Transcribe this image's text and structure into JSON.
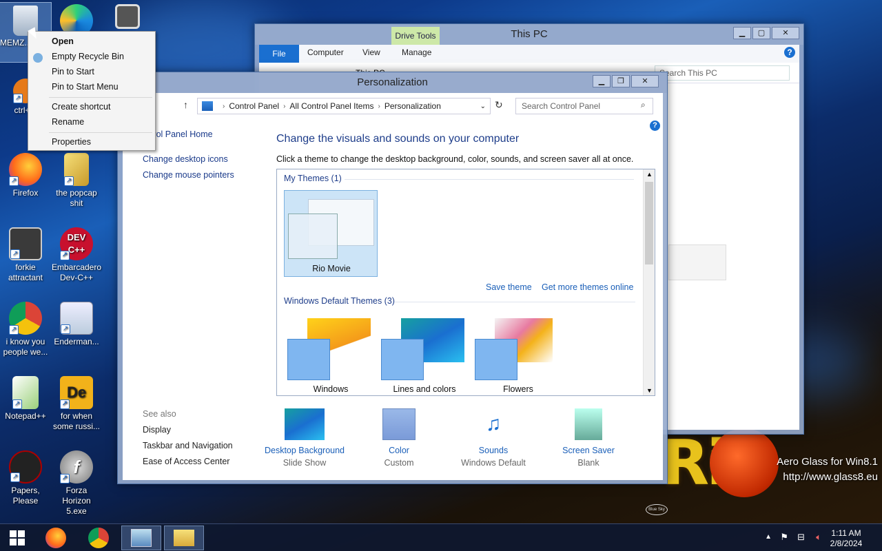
{
  "desktop": {
    "icons": [
      {
        "id": "recycle",
        "label": "MEMZ...uctive"
      },
      {
        "id": "edge",
        "label": ""
      },
      {
        "id": "stack",
        "label": ""
      },
      {
        "id": "ctrl",
        "label": "ctrl+a,"
      },
      {
        "id": "firefox",
        "label": "Firefox"
      },
      {
        "id": "popcap",
        "label": "the popcap shit"
      },
      {
        "id": "forkie",
        "label": "forkie attractant"
      },
      {
        "id": "devcpp",
        "label": "Embarcadero Dev-C++"
      },
      {
        "id": "chrome",
        "label": "i know you people we..."
      },
      {
        "id": "enderman",
        "label": "Enderman..."
      },
      {
        "id": "notepad",
        "label": "Notepad++"
      },
      {
        "id": "russian",
        "label": "for when some russi..."
      },
      {
        "id": "papers",
        "label": "Papers, Please"
      },
      {
        "id": "forza",
        "label": "Forza Horizon 5.exe"
      }
    ],
    "watermark_line1": "Aero Glass for Win8.1",
    "watermark_line2": "http://www.glass8.eu",
    "devcpp_badge": "DEV C++",
    "rio_text": "RiO",
    "bluesky": "Blue Sky"
  },
  "context_menu": {
    "items": [
      "Open",
      "Empty Recycle Bin",
      "Pin to Start",
      "Pin to Start Menu",
      "Create shortcut",
      "Rename",
      "Properties"
    ]
  },
  "explorer": {
    "title": "This PC",
    "drive_tools": "Drive Tools",
    "tabs": [
      "File",
      "Computer",
      "View",
      "Manage"
    ],
    "address": "This PC",
    "search_placeholder": "Search This PC"
  },
  "personalization": {
    "title": "Personalization",
    "breadcrumb": [
      "Control Panel",
      "All Control Panel Items",
      "Personalization"
    ],
    "search_placeholder": "Search Control Panel",
    "left_links": [
      "Control Panel Home",
      "Change desktop icons",
      "Change mouse pointers"
    ],
    "heading": "Change the visuals and sounds on your computer",
    "description": "Click a theme to change the desktop background, color, sounds, and screen saver all at once.",
    "my_themes_label": "My Themes (1)",
    "my_theme_name": "Rio Movie",
    "save_theme": "Save theme",
    "get_more": "Get more themes online",
    "default_themes_label": "Windows Default Themes (3)",
    "default_themes": [
      "Windows",
      "Lines and colors",
      "Flowers"
    ],
    "see_also": "See also",
    "see_also_links": [
      "Display",
      "Taskbar and Navigation",
      "Ease of Access Center"
    ],
    "bottom": [
      {
        "name": "Desktop Background",
        "sub": "Slide Show"
      },
      {
        "name": "Color",
        "sub": "Custom"
      },
      {
        "name": "Sounds",
        "sub": "Windows Default"
      },
      {
        "name": "Screen Saver",
        "sub": "Blank"
      }
    ]
  },
  "taskbar": {
    "time": "1:11 AM",
    "date": "2/8/2024"
  }
}
